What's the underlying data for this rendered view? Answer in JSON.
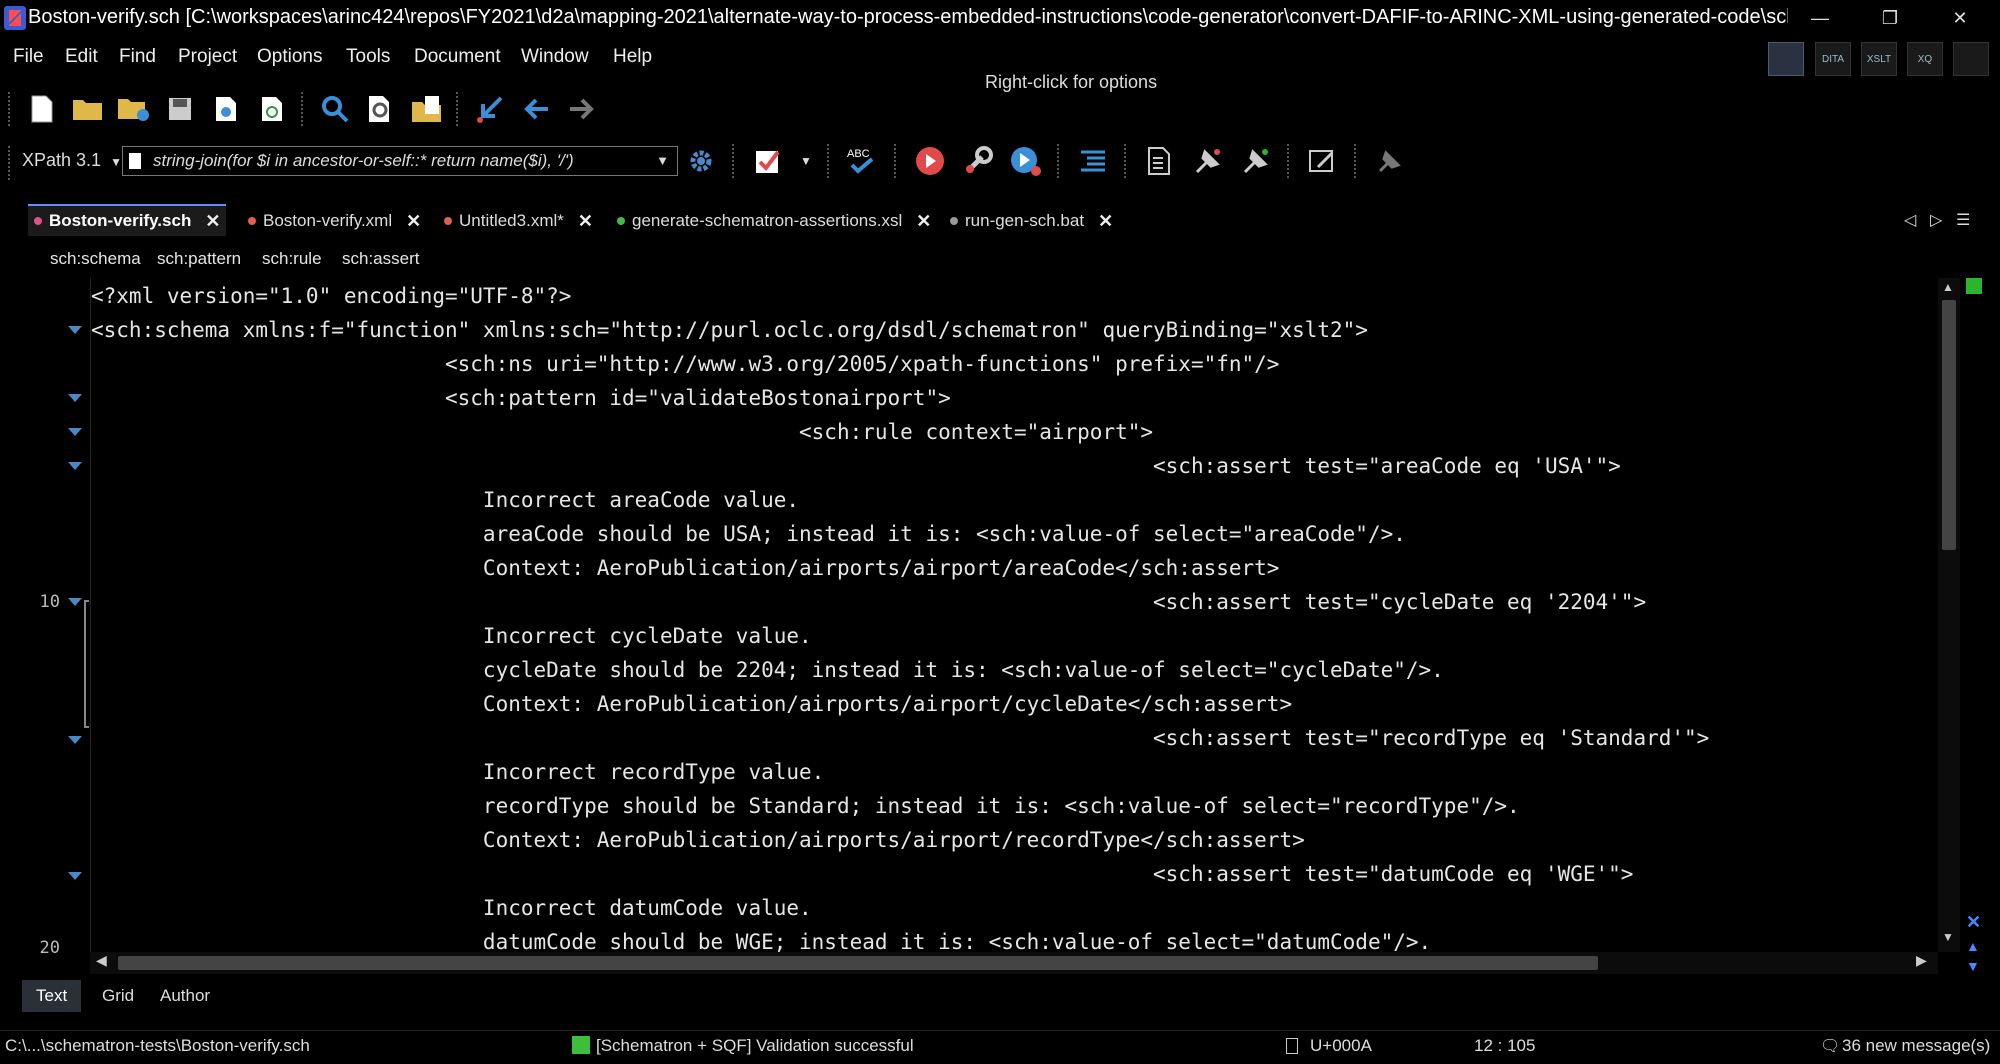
{
  "window": {
    "title": "Boston-verify.sch [C:\\workspaces\\arinc424\\repos\\FY2021\\d2a\\mapping-2021\\alternate-way-to-process-embedded-instructions\\code-generator\\convert-DAFIF-to-ARINC-XML-using-generated-code\\schematron-...",
    "minimize": "—",
    "restore": "❐",
    "close": "✕"
  },
  "menu": [
    "File",
    "Edit",
    "Find",
    "Project",
    "Options",
    "Tools",
    "Document",
    "Window",
    "Help"
  ],
  "hint": "Right-click for options",
  "perspectives": [
    "",
    "DITA",
    "XSLT",
    "XQ",
    ""
  ],
  "xpath": {
    "version_label": "XPath 3.1",
    "expression": "string-join(for $i in ancestor-or-self::* return name($i), '/')"
  },
  "tabs": [
    {
      "label": "Boston-verify.sch",
      "dot": "#e0518a",
      "active": true
    },
    {
      "label": "Boston-verify.xml",
      "dot": "#e0604a",
      "active": false
    },
    {
      "label": "Untitled3.xml*",
      "dot": "#e0604a",
      "active": false
    },
    {
      "label": "generate-schematron-assertions.xsl",
      "dot": "#44b844",
      "active": false
    },
    {
      "label": "run-gen-sch.bat",
      "dot": "#999999",
      "active": false
    }
  ],
  "breadcrumb": [
    "sch:schema",
    "sch:pattern",
    "sch:rule",
    "sch:assert"
  ],
  "line_numbers": {
    "ten": "10",
    "twenty": "20"
  },
  "code_lines": [
    "<?xml version=\"1.0\" encoding=\"UTF-8\"?>",
    "<sch:schema xmlns:f=\"function\" xmlns:sch=\"http://purl.oclc.org/dsdl/schematron\" queryBinding=\"xslt2\">",
    "                            <sch:ns uri=\"http://www.w3.org/2005/xpath-functions\" prefix=\"fn\"/>",
    "                            <sch:pattern id=\"validateBostonairport\">",
    "                                                        <sch:rule context=\"airport\">",
    "                                                                                    <sch:assert test=\"areaCode eq 'USA'\">",
    "                               Incorrect areaCode value.",
    "                               areaCode should be USA; instead it is: <sch:value-of select=\"areaCode\"/>.",
    "                               Context: AeroPublication/airports/airport/areaCode</sch:assert>",
    "                                                                                    <sch:assert test=\"cycleDate eq '2204'\">",
    "                               Incorrect cycleDate value.",
    "                               cycleDate should be 2204; instead it is: <sch:value-of select=\"cycleDate\"/>.",
    "                               Context: AeroPublication/airports/airport/cycleDate</sch:assert>",
    "                                                                                    <sch:assert test=\"recordType eq 'Standard'\">",
    "                               Incorrect recordType value.",
    "                               recordType should be Standard; instead it is: <sch:value-of select=\"recordType\"/>.",
    "                               Context: AeroPublication/airports/airport/recordType</sch:assert>",
    "                                                                                    <sch:assert test=\"datumCode eq 'WGE'\">",
    "                               Incorrect datumCode value.",
    "                               datumCode should be WGE; instead it is: <sch:value-of select=\"datumCode\"/>."
  ],
  "modes": [
    "Text",
    "Grid",
    "Author"
  ],
  "status": {
    "path": "C:\\...\\schematron-tests\\Boston-verify.sch",
    "validation": "[Schematron + SQF] Validation successful",
    "char": "U+000A",
    "position": "12 : 105",
    "messages": "36 new message(s)"
  }
}
